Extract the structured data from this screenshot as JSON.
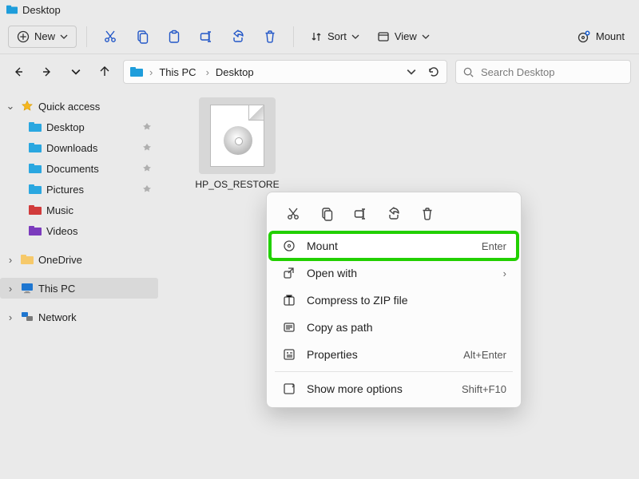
{
  "title": "Desktop",
  "toolbar": {
    "new_label": "New",
    "sort_label": "Sort",
    "view_label": "View",
    "mount_label": "Mount"
  },
  "breadcrumb": [
    "This PC",
    "Desktop"
  ],
  "search_placeholder": "Search Desktop",
  "sidebar": {
    "quick_access": "Quick access",
    "items": [
      {
        "label": "Desktop",
        "pinned": true,
        "color": "#2aa7e0"
      },
      {
        "label": "Downloads",
        "pinned": true,
        "color": "#2aa7e0"
      },
      {
        "label": "Documents",
        "pinned": true,
        "color": "#2aa7e0"
      },
      {
        "label": "Pictures",
        "pinned": true,
        "color": "#2aa7e0"
      },
      {
        "label": "Music",
        "pinned": false,
        "color": "#d13b3b"
      },
      {
        "label": "Videos",
        "pinned": false,
        "color": "#7b3bbd"
      }
    ],
    "onedrive": "OneDrive",
    "this_pc": "This PC",
    "network": "Network"
  },
  "file": {
    "name": "HP_OS_RESTORE"
  },
  "context_menu": {
    "items": [
      {
        "label": "Mount",
        "accel": "Enter",
        "icon": "disc",
        "highlight": true
      },
      {
        "label": "Open with",
        "accel": "",
        "icon": "openwith",
        "chevron": true
      },
      {
        "label": "Compress to ZIP file",
        "accel": "",
        "icon": "zip"
      },
      {
        "label": "Copy as path",
        "accel": "",
        "icon": "copypath"
      },
      {
        "label": "Properties",
        "accel": "Alt+Enter",
        "icon": "props"
      },
      {
        "label": "Show more options",
        "accel": "Shift+F10",
        "icon": "more"
      }
    ]
  }
}
